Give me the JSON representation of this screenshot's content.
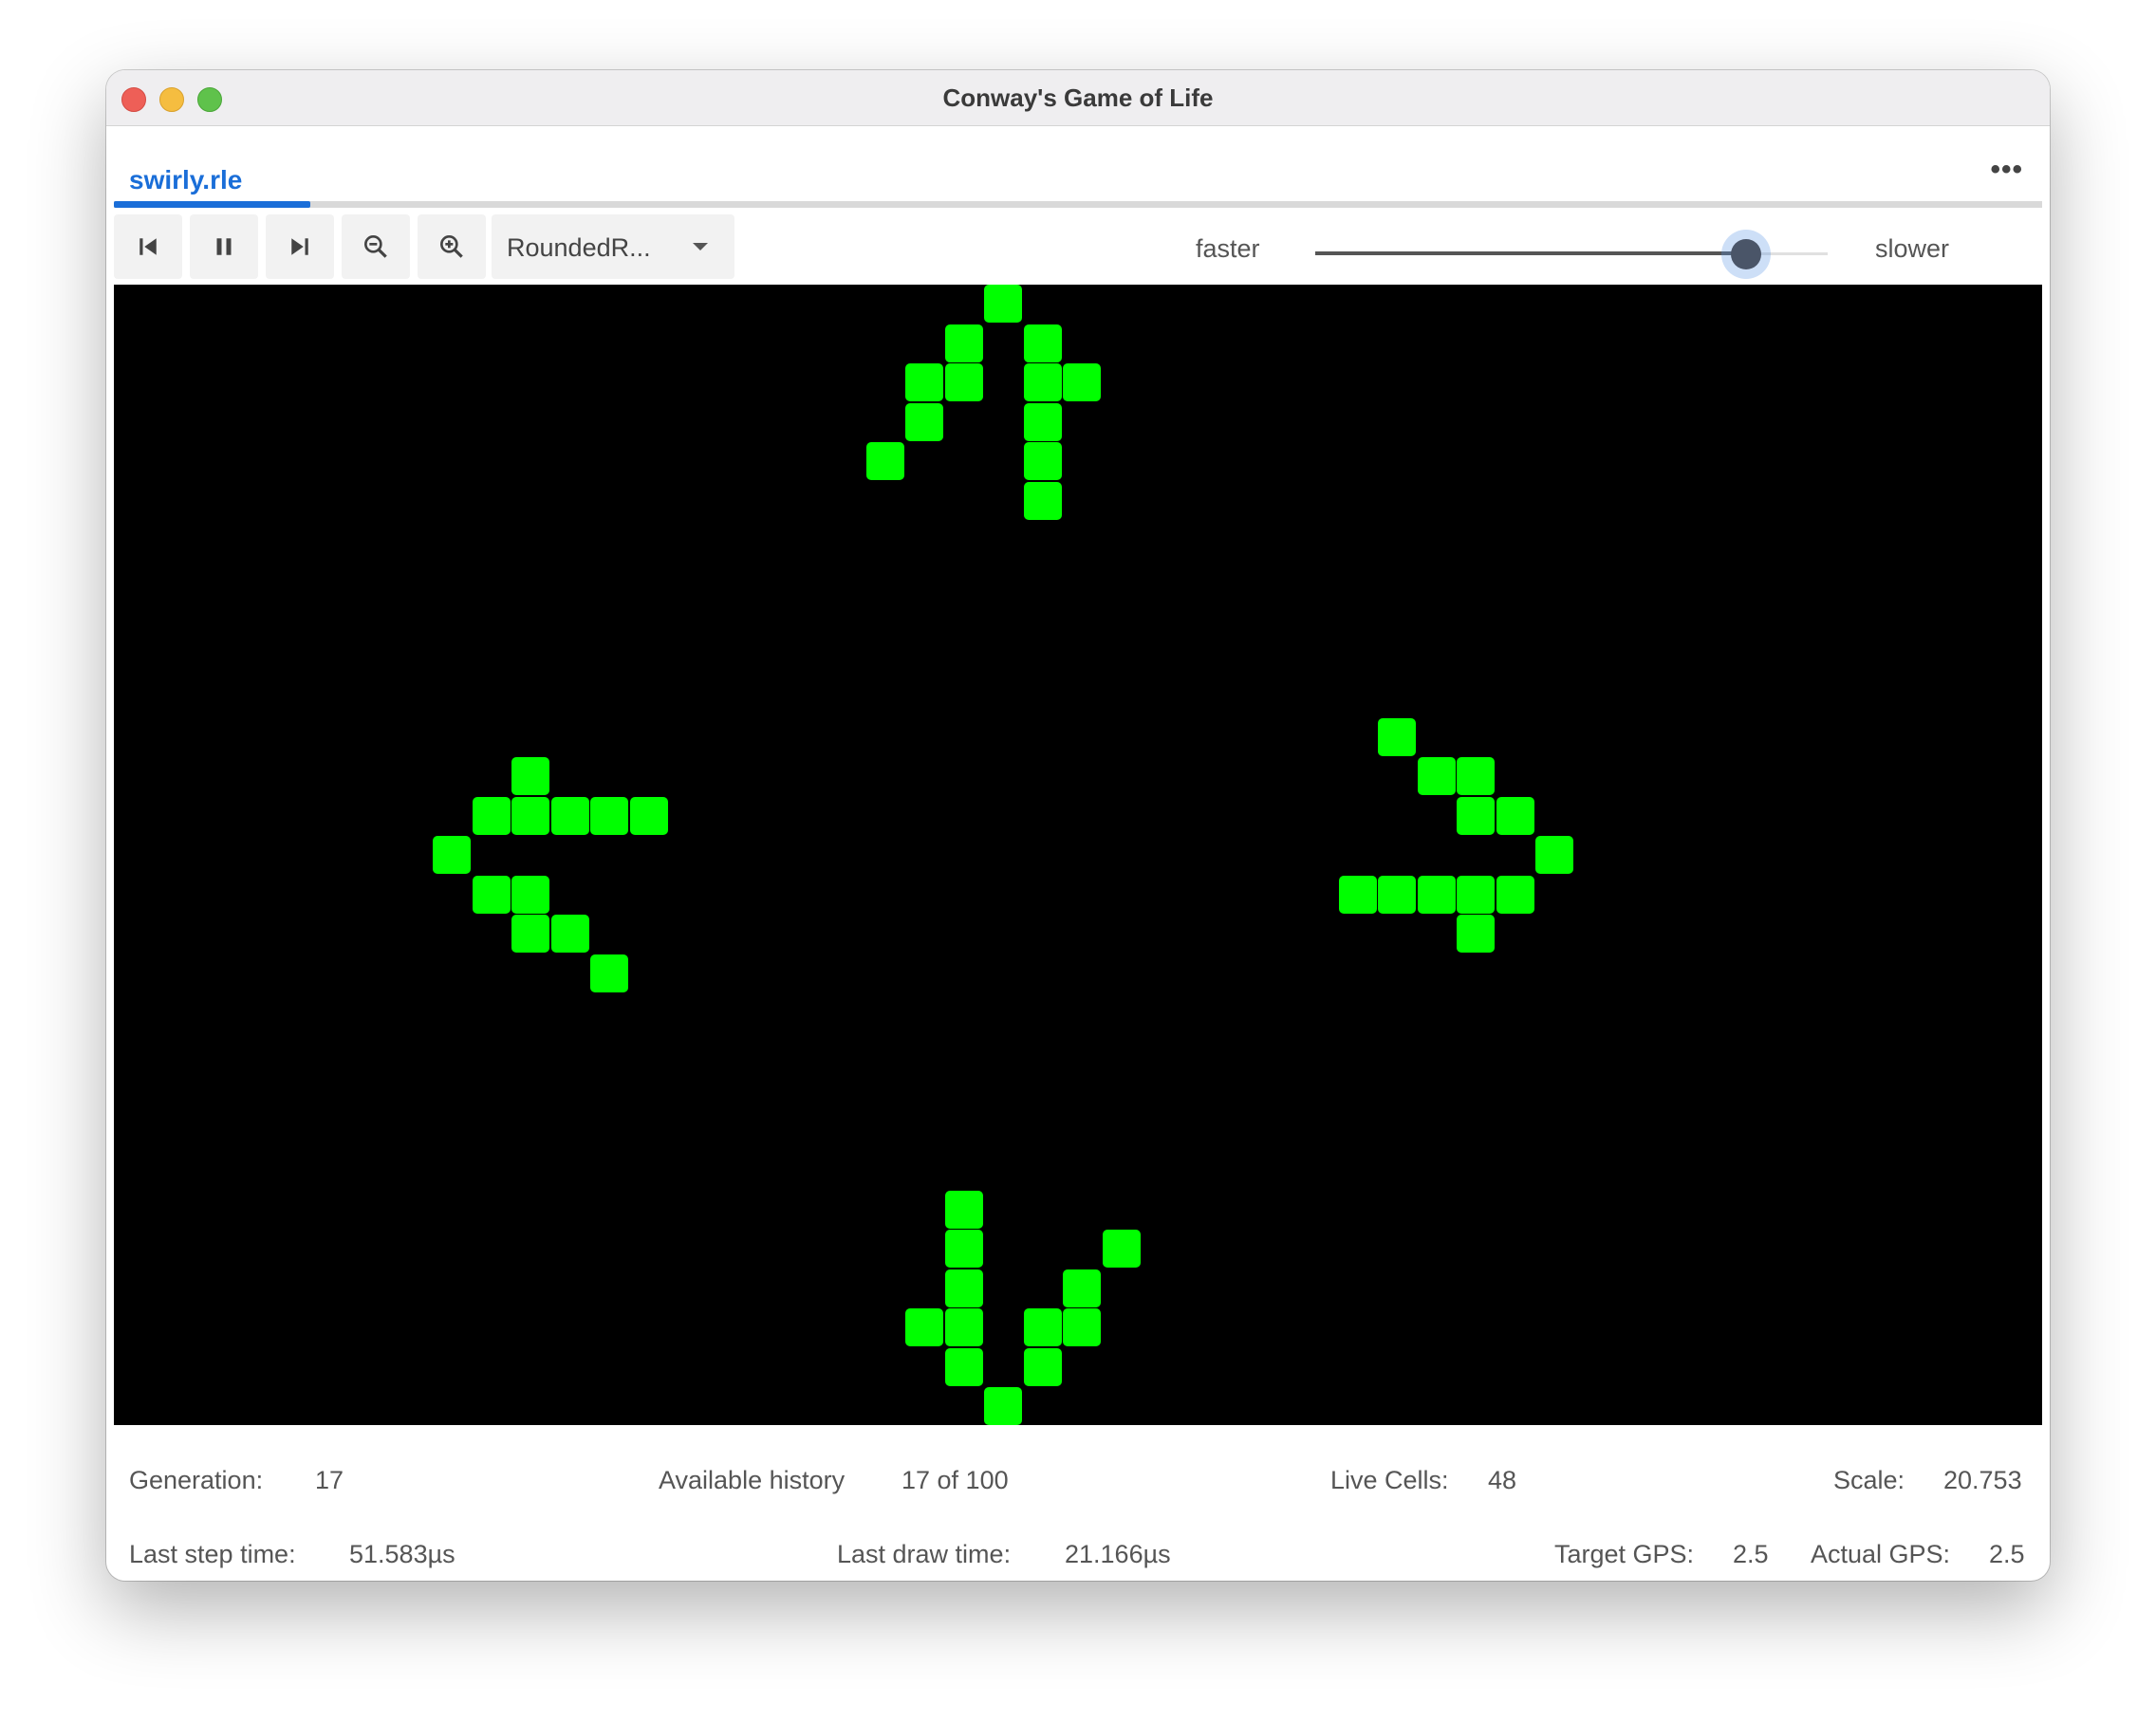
{
  "window": {
    "title": "Conway's Game of Life"
  },
  "tab": {
    "label": "swirly.rle",
    "more_label": "•••"
  },
  "toolbar": {
    "buttons": [
      {
        "name": "skip-to-start-button",
        "icon": "skip-back-icon"
      },
      {
        "name": "pause-button",
        "icon": "pause-icon"
      },
      {
        "name": "step-forward-button",
        "icon": "skip-forward-icon"
      },
      {
        "name": "zoom-out-button",
        "icon": "zoom-out-icon"
      },
      {
        "name": "zoom-in-button",
        "icon": "zoom-in-icon"
      }
    ],
    "renderer_select": {
      "value": "RoundedR..."
    },
    "speed": {
      "faster_label": "faster",
      "slower_label": "slower",
      "level": 0.84
    }
  },
  "board": {
    "background": "#000000",
    "cell_color": "#00ff00",
    "live_cells": [
      [
        24,
        0
      ],
      [
        23,
        1
      ],
      [
        25,
        1
      ],
      [
        22,
        2
      ],
      [
        23,
        2
      ],
      [
        25,
        2
      ],
      [
        26,
        2
      ],
      [
        22,
        3
      ],
      [
        25,
        3
      ],
      [
        21,
        4
      ],
      [
        25,
        4
      ],
      [
        25,
        5
      ],
      [
        34,
        11
      ],
      [
        12,
        12
      ],
      [
        35,
        12
      ],
      [
        36,
        12
      ],
      [
        11,
        13
      ],
      [
        12,
        13
      ],
      [
        13,
        13
      ],
      [
        14,
        13
      ],
      [
        15,
        13
      ],
      [
        36,
        13
      ],
      [
        37,
        13
      ],
      [
        10,
        14
      ],
      [
        38,
        14
      ],
      [
        11,
        15
      ],
      [
        12,
        15
      ],
      [
        33,
        15
      ],
      [
        34,
        15
      ],
      [
        35,
        15
      ],
      [
        36,
        15
      ],
      [
        37,
        15
      ],
      [
        12,
        16
      ],
      [
        13,
        16
      ],
      [
        36,
        16
      ],
      [
        14,
        17
      ],
      [
        23,
        23
      ],
      [
        23,
        24
      ],
      [
        27,
        24
      ],
      [
        23,
        25
      ],
      [
        26,
        25
      ],
      [
        22,
        26
      ],
      [
        23,
        26
      ],
      [
        25,
        26
      ],
      [
        26,
        26
      ],
      [
        23,
        27
      ],
      [
        25,
        27
      ],
      [
        24,
        28
      ]
    ]
  },
  "stats": {
    "generation_label": "Generation:",
    "generation": "17",
    "history_label": "Available history",
    "history": "17 of 100",
    "live_cells_label": "Live Cells:",
    "live_cells": "48",
    "scale_label": "Scale:",
    "scale": "20.753",
    "step_time_label": "Last step time:",
    "step_time": "51.583µs",
    "draw_time_label": "Last draw time:",
    "draw_time": "21.166µs",
    "target_gps_label": "Target GPS:",
    "target_gps": "2.5",
    "actual_gps_label": "Actual GPS:",
    "actual_gps": "2.5"
  }
}
